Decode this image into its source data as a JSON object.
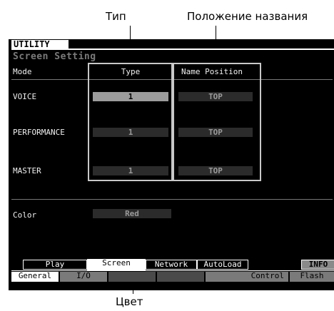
{
  "callouts": {
    "type": "Тип",
    "name_position": "Положение названия",
    "color": "Цвет"
  },
  "screen": {
    "header_tab": "UTILITY",
    "title": "Screen Setting",
    "columns": {
      "mode": "Mode",
      "type": "Type",
      "name_position": "Name Position"
    },
    "rows": [
      {
        "label": "VOICE",
        "type": "1",
        "name_position": "TOP"
      },
      {
        "label": "PERFORMANCE",
        "type": "1",
        "name_position": "TOP"
      },
      {
        "label": "MASTER",
        "type": "1",
        "name_position": "TOP"
      }
    ],
    "color_label": "Color",
    "color_value": "Red",
    "upper_tabs": [
      "Play",
      "Screen",
      "Network",
      "AutoLoad",
      "INFO"
    ],
    "lower_tabs": [
      "General",
      "I/O",
      "Control",
      "Flash"
    ]
  }
}
